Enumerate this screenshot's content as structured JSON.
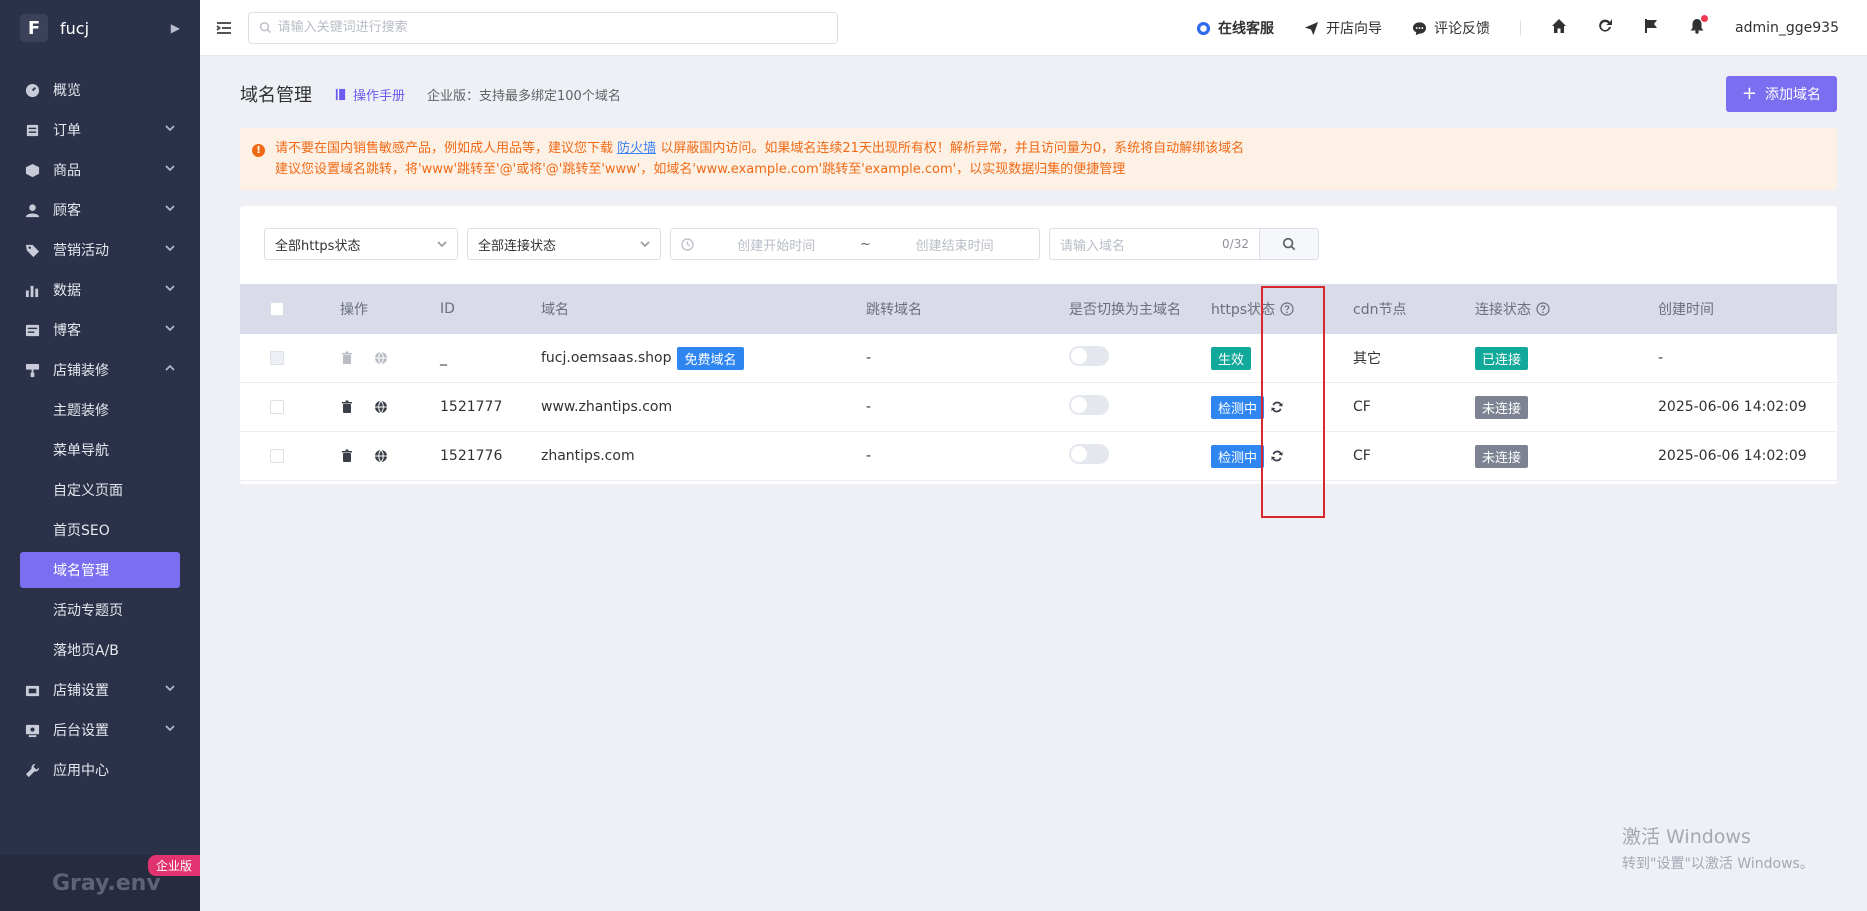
{
  "app": {
    "logo_letter": "F",
    "name": "fucj",
    "footer_name": "Gray.env",
    "edition_badge": "企业版"
  },
  "sidebar": {
    "items": [
      {
        "label": "概览",
        "icon": "dashboard-icon",
        "expandable": false
      },
      {
        "label": "订单",
        "icon": "order-icon",
        "expandable": true
      },
      {
        "label": "商品",
        "icon": "product-icon",
        "expandable": true
      },
      {
        "label": "顾客",
        "icon": "customer-icon",
        "expandable": true
      },
      {
        "label": "营销活动",
        "icon": "tag-icon",
        "expandable": true
      },
      {
        "label": "数据",
        "icon": "chart-icon",
        "expandable": true
      },
      {
        "label": "博客",
        "icon": "blog-icon",
        "expandable": true
      },
      {
        "label": "店铺装修",
        "icon": "brush-icon",
        "expandable": true,
        "expanded": true
      }
    ],
    "sub_items": [
      "主题装修",
      "菜单导航",
      "自定义页面",
      "首页SEO",
      "域名管理",
      "活动专题页",
      "落地页A/B"
    ],
    "active_sub": "域名管理",
    "bottom_items": [
      {
        "label": "店铺设置",
        "icon": "store-icon"
      },
      {
        "label": "后台设置",
        "icon": "settings-icon"
      },
      {
        "label": "应用中心",
        "icon": "wrench-icon"
      }
    ]
  },
  "topbar": {
    "search_placeholder": "请输入关键词进行搜索",
    "links": {
      "service": "在线客服",
      "guide": "开店向导",
      "feedback": "评论反馈"
    },
    "user": "admin_gge935"
  },
  "page": {
    "title": "域名管理",
    "manual": "操作手册",
    "plan_note": "企业版：支持最多绑定100个域名",
    "add_button": "添加域名"
  },
  "notice": {
    "line1_before": "请不要在国内销售敏感产品，例如成人用品等，建议您下载",
    "line1_link": "防火墙",
    "line1_after": "以屏蔽国内访问。如果域名连续21天出现所有权！解析异常，并且访问量为0，系统将自动解绑该域名",
    "line2": "建议您设置域名跳转，将'www'跳转至'@'或将'@'跳转至'www'，如域名'www.example.com'跳转至'example.com'，以实现数据归集的便捷管理"
  },
  "filters": {
    "https_status": "全部https状态",
    "connect_status": "全部连接状态",
    "start_placeholder": "创建开始时间",
    "range_sep": "~",
    "end_placeholder": "创建结束时间",
    "domain_placeholder": "请输入域名",
    "domain_count": "0/32"
  },
  "table": {
    "headers": {
      "op": "操作",
      "id": "ID",
      "domain": "域名",
      "jump": "跳转域名",
      "main": "是否切换为主域名",
      "https": "https状态",
      "cdn": "cdn节点",
      "conn": "连接状态",
      "time": "创建时间"
    },
    "rows": [
      {
        "id": "_",
        "domain": "fucj.oemsaas.shop",
        "free_tag": "免费域名",
        "jump": "-",
        "https": "生效",
        "cdn": "其它",
        "conn": "已连接",
        "time": "-"
      },
      {
        "id": "1521777",
        "domain": "www.zhantips.com",
        "free_tag": "",
        "jump": "-",
        "https": "检测中",
        "cdn": "CF",
        "conn": "未连接",
        "time": "2025-06-06 14:02:09"
      },
      {
        "id": "1521776",
        "domain": "zhantips.com",
        "free_tag": "",
        "jump": "-",
        "https": "检测中",
        "cdn": "CF",
        "conn": "未连接",
        "time": "2025-06-06 14:02:09"
      }
    ]
  },
  "windows_watermark": {
    "line1": "激活 Windows",
    "line2": "转到\"设置\"以激活 Windows。"
  },
  "colors": {
    "accent": "#7b6ef0",
    "sidebar": "#2b3148",
    "warning": "#f06a16",
    "success": "#12a99a",
    "info": "#2f86f0",
    "muted": "#7d8392"
  }
}
